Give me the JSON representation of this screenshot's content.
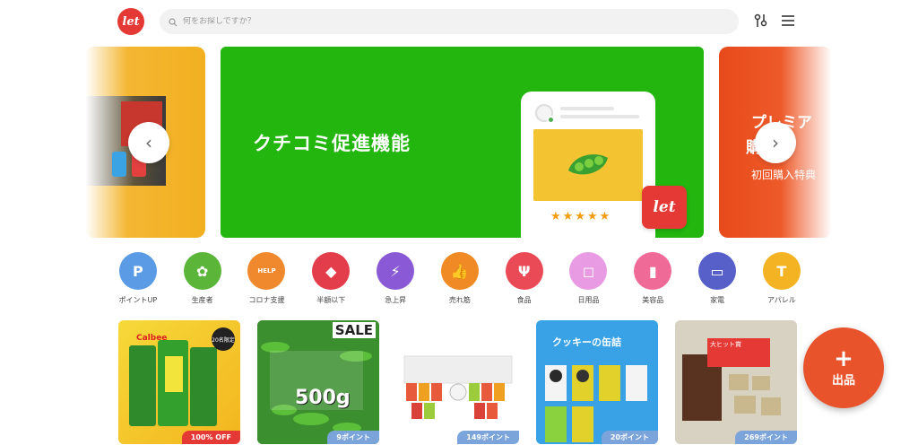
{
  "header": {
    "logo_text": "let",
    "search_placeholder": "何をお探しですか？"
  },
  "banner": {
    "main_title": "クチコミ促進機能",
    "main_badge": "let",
    "right_title_1": "プレミア",
    "right_title_2": "購入",
    "right_subtitle": "初回購入特典",
    "stars": "★★★★★"
  },
  "categories": [
    {
      "label": "ポイントUP",
      "icon": "p-icon",
      "glyph": "P",
      "color": "#5b9be6"
    },
    {
      "label": "生産者",
      "icon": "sprout-icon",
      "glyph": "✿",
      "color": "#5bb539"
    },
    {
      "label": "コロナ支援",
      "icon": "help-icon",
      "glyph": "HELP",
      "color": "#f0892d"
    },
    {
      "label": "半額以下",
      "icon": "price-tag-icon",
      "glyph": "◆",
      "color": "#e33c4b"
    },
    {
      "label": "急上昇",
      "icon": "lightning-icon",
      "glyph": "⚡",
      "color": "#8a5ad6"
    },
    {
      "label": "売れ筋",
      "icon": "thumbs-up-icon",
      "glyph": "👍",
      "color": "#f08a24"
    },
    {
      "label": "食品",
      "icon": "utensils-icon",
      "glyph": "Ψ",
      "color": "#ea4a56"
    },
    {
      "label": "日用品",
      "icon": "bag-icon",
      "glyph": "◻",
      "color": "#e89be3"
    },
    {
      "label": "美容品",
      "icon": "cosmetics-icon",
      "glyph": "▮",
      "color": "#ef6a96"
    },
    {
      "label": "家電",
      "icon": "tv-icon",
      "glyph": "▭",
      "color": "#5660c8"
    },
    {
      "label": "アパレル",
      "icon": "tshirt-icon",
      "glyph": "T",
      "color": "#f4b323"
    }
  ],
  "products": [
    {
      "name": "potato-snack",
      "tag": "100% OFF",
      "badge": "20名限定",
      "tag_color": "#e53935"
    },
    {
      "name": "edamame",
      "tag": "9ポイント",
      "sale": "SALE",
      "weight": "500g",
      "tag_color": "#7ba4db"
    },
    {
      "name": "jelly-set",
      "tag": "149ポイント",
      "tag_color": "#7ba4db"
    },
    {
      "name": "cookie-can",
      "tag": "20ポイント",
      "title": "クッキーの缶詰",
      "tag_color": "#7ba4db"
    },
    {
      "name": "chocolate-outlet",
      "tag": "269ポイント",
      "note": "大ヒット賞",
      "tag_color": "#7ba4db"
    }
  ],
  "fab": {
    "plus": "+",
    "label": "出品"
  }
}
